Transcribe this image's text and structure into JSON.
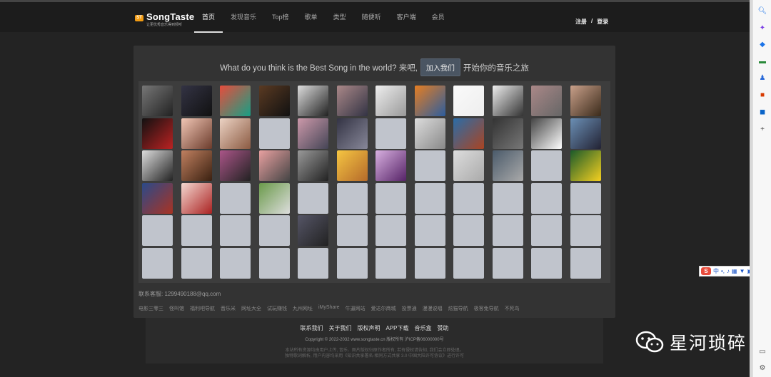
{
  "header": {
    "logo_badge": "ST",
    "logo_text": "SongTaste",
    "logo_sub": "让更优秀音乐得到倾听",
    "nav": [
      {
        "label": "首页",
        "active": true
      },
      {
        "label": "发现音乐"
      },
      {
        "label": "Top榜"
      },
      {
        "label": "歌单"
      },
      {
        "label": "类型"
      },
      {
        "label": "随便听"
      },
      {
        "label": "客户端"
      },
      {
        "label": "会员"
      }
    ],
    "register": "注册",
    "separator": "/",
    "login": "登录"
  },
  "welcome": {
    "question": "What do you think is the Best Song in the world? 来吧,",
    "join_button": "加入我们",
    "suffix": "开始你的音乐之旅"
  },
  "grid": {
    "rows": 6,
    "cols": 12,
    "filled": [
      {
        "i": 0,
        "c1": "#777",
        "c2": "#222"
      },
      {
        "i": 1,
        "c1": "#334",
        "c2": "#111"
      },
      {
        "i": 2,
        "c1": "#e74c3c",
        "c2": "#16a085"
      },
      {
        "i": 3,
        "c1": "#5a3a22",
        "c2": "#111"
      },
      {
        "i": 4,
        "c1": "#ddd",
        "c2": "#222"
      },
      {
        "i": 5,
        "c1": "#a88",
        "c2": "#334"
      },
      {
        "i": 6,
        "c1": "#eee",
        "c2": "#999"
      },
      {
        "i": 7,
        "c1": "#e67e22",
        "c2": "#2c5d9e"
      },
      {
        "i": 8,
        "c1": "#fafafa",
        "c2": "#eee"
      },
      {
        "i": 9,
        "c1": "#eee",
        "c2": "#333"
      },
      {
        "i": 10,
        "c1": "#a88",
        "c2": "#666"
      },
      {
        "i": 11,
        "c1": "#c9a08a",
        "c2": "#3a2a1a"
      },
      {
        "i": 12,
        "c1": "#111",
        "c2": "#b22"
      },
      {
        "i": 13,
        "c1": "#f1c6b5",
        "c2": "#6b3b2b"
      },
      {
        "i": 14,
        "c1": "#ecd3c4",
        "c2": "#8b5a42"
      },
      {
        "i": 16,
        "c1": "#c9a",
        "c2": "#445"
      },
      {
        "i": 17,
        "c1": "#334",
        "c2": "#889"
      },
      {
        "i": 19,
        "c1": "#ddd",
        "c2": "#888"
      },
      {
        "i": 20,
        "c1": "#2a6da8",
        "c2": "#aa4422"
      },
      {
        "i": 21,
        "c1": "#333",
        "c2": "#777"
      },
      {
        "i": 22,
        "c1": "#444",
        "c2": "#fff"
      },
      {
        "i": 23,
        "c1": "#6b8fb5",
        "c2": "#223"
      },
      {
        "i": 24,
        "c1": "#ddd",
        "c2": "#222"
      },
      {
        "i": 25,
        "c1": "#c08060",
        "c2": "#3a2010"
      },
      {
        "i": 26,
        "c1": "#a58",
        "c2": "#222"
      },
      {
        "i": 27,
        "c1": "#e8a0a0",
        "c2": "#444"
      },
      {
        "i": 28,
        "c1": "#999",
        "c2": "#222"
      },
      {
        "i": 29,
        "c1": "#f5c542",
        "c2": "#b56a2a"
      },
      {
        "i": 30,
        "c1": "#d8b0e0",
        "c2": "#552266"
      },
      {
        "i": 32,
        "c1": "#ddd",
        "c2": "#aaa"
      },
      {
        "i": 33,
        "c1": "#4a5a6a",
        "c2": "#aaa"
      },
      {
        "i": 35,
        "c1": "#1a5a2a",
        "c2": "#f5d020"
      },
      {
        "i": 36,
        "c1": "#2a4a8a",
        "c2": "#aa3322"
      },
      {
        "i": 37,
        "c1": "#f4d8d0",
        "c2": "#aa2222"
      },
      {
        "i": 39,
        "c1": "#6a9a4a",
        "c2": "#ddd"
      },
      {
        "i": 52,
        "c1": "#556",
        "c2": "#222"
      }
    ]
  },
  "contact": "联系客服: 1299490188@qq.com",
  "friend_links": [
    "电影三零三",
    "怪叫馆",
    "福利吧导航",
    "音乐米",
    "网址大全",
    "试玩赚钱",
    "九州网址",
    "iMyShare",
    "牛逼网站",
    "爱达尔商城",
    "投票通",
    "漫漫说唱",
    "炫猫导航",
    "极客免导航",
    "不死鸟"
  ],
  "footer": {
    "links": [
      "联系我们",
      "关于我们",
      "版权声明",
      "APP下载",
      "音乐盒",
      "赞助"
    ],
    "copyright": "Copyright © 2022-2032 www.songtaste.cn 版权所有 沪ICP备06000000号",
    "disclaimer_1": "本站所有资源均由用户上传, 音乐、图片版权归原作者所有, 若有侵权请告知, 我们会立即处理。",
    "disclaimer_2": "独特歌词解析, 用户内容均采用《知识共享署名-相同方式共享 3.0 中国大陆许可协议》进行许可"
  },
  "watermark": "星河琐碎",
  "ime": {
    "logo": "S",
    "label": "中"
  },
  "colors": {
    "accent": "#f39c12",
    "panel": "#333333",
    "placeholder": "#c0c4cc"
  }
}
